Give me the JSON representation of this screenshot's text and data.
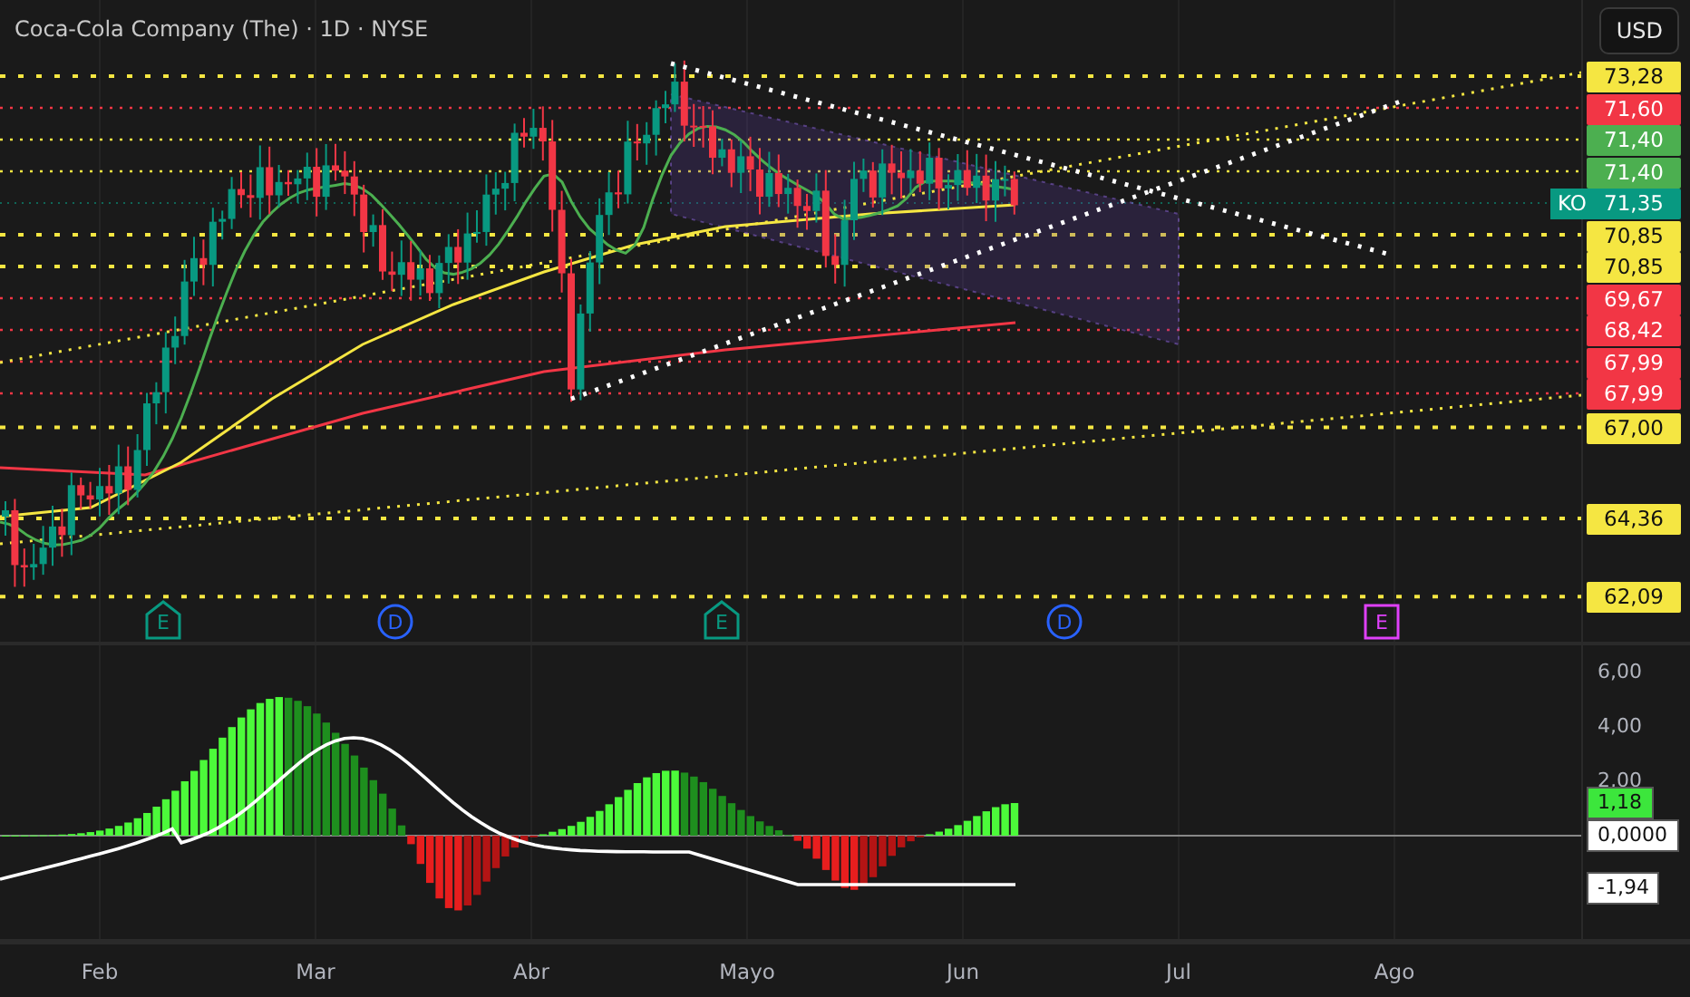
{
  "header": {
    "title": "Coca-Cola Company (The) · 1D · NYSE",
    "currency": "USD"
  },
  "price_axis": {
    "symbol_tag": "KO",
    "labels": [
      {
        "text": "73,28",
        "kind": "line",
        "color": "#f5e642"
      },
      {
        "text": "71,60",
        "kind": "line",
        "color": "#f23645"
      },
      {
        "text": "71,40",
        "kind": "line",
        "color": "#4caf50"
      },
      {
        "text": "71,40",
        "kind": "line",
        "color": "#4caf50"
      },
      {
        "text": "71,35",
        "kind": "current",
        "color": "#089981"
      },
      {
        "text": "70,85",
        "kind": "line",
        "color": "#f5e642"
      },
      {
        "text": "70,85",
        "kind": "line",
        "color": "#f5e642"
      },
      {
        "text": "69,67",
        "kind": "line",
        "color": "#f23645"
      },
      {
        "text": "68,42",
        "kind": "line",
        "color": "#f23645"
      },
      {
        "text": "67,99",
        "kind": "line",
        "color": "#f23645"
      },
      {
        "text": "67,99",
        "kind": "line",
        "color": "#f23645"
      },
      {
        "text": "67,00",
        "kind": "line",
        "color": "#f5e642"
      },
      {
        "text": "64,36",
        "kind": "line",
        "color": "#f5e642"
      },
      {
        "text": "62,09",
        "kind": "line",
        "color": "#f5e642"
      }
    ]
  },
  "events": [
    {
      "letter": "E",
      "kind": "earnings",
      "color": "#089981"
    },
    {
      "letter": "D",
      "kind": "dividend",
      "color": "#2962ff"
    },
    {
      "letter": "E",
      "kind": "earnings",
      "color": "#089981"
    },
    {
      "letter": "D",
      "kind": "dividend",
      "color": "#2962ff"
    },
    {
      "letter": "E",
      "kind": "upcoming",
      "color": "#e040fb"
    }
  ],
  "indicator": {
    "ticks": [
      "6,00",
      "4,00",
      "2,00"
    ],
    "labels": [
      {
        "text": "1,18",
        "kind": "histogram"
      },
      {
        "text": "0,0000",
        "kind": "zero"
      },
      {
        "text": "-1,94",
        "kind": "signal"
      }
    ]
  },
  "time_axis": [
    "Feb",
    "Mar",
    "Abr",
    "Mayo",
    "Jun",
    "Jul",
    "Ago"
  ]
}
